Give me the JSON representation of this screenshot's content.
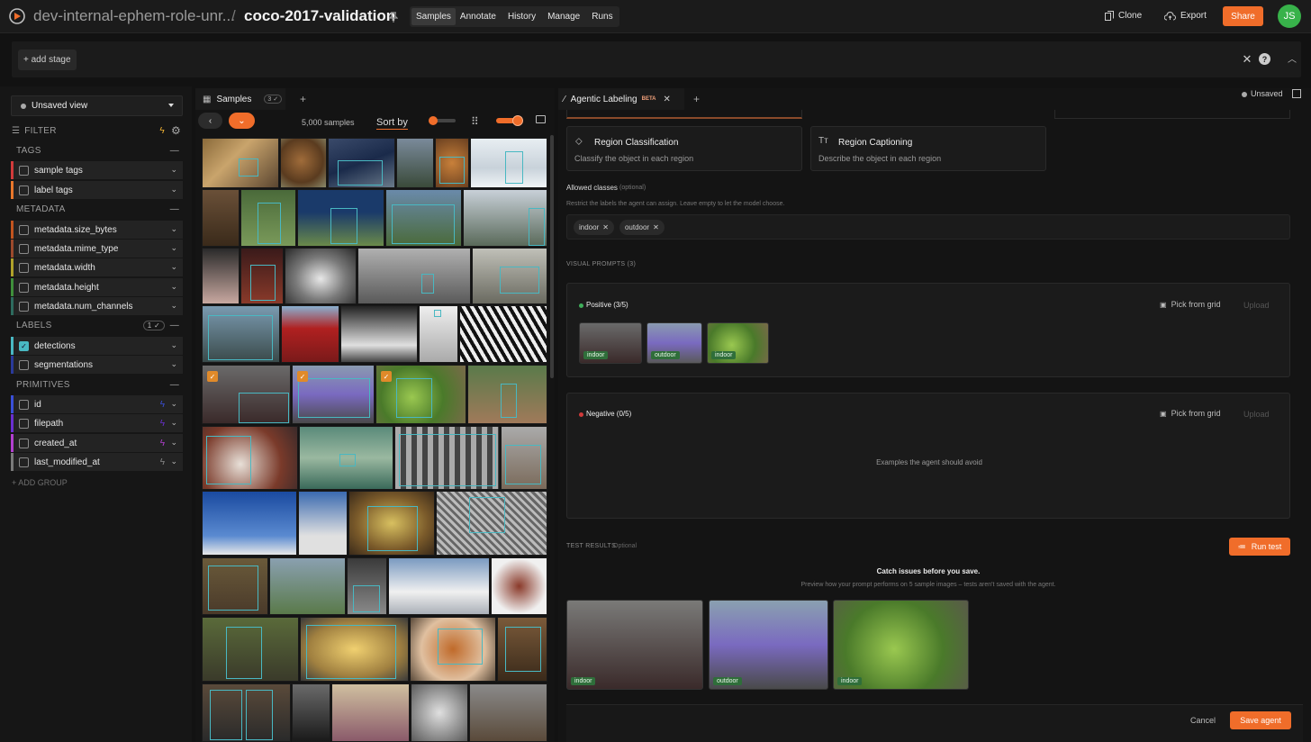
{
  "header": {
    "org": "dev-internal-ephem-role-unr...",
    "separator": "/",
    "dataset": "coco-2017-validation",
    "tabs": [
      {
        "label": "Samples",
        "active": true
      },
      {
        "label": "Annotate",
        "active": false
      },
      {
        "label": "History",
        "active": false
      },
      {
        "label": "Manage",
        "active": false
      },
      {
        "label": "Runs",
        "active": false
      }
    ],
    "clone_label": "Clone",
    "export_label": "Export",
    "share_label": "Share",
    "avatar_initials": "JS",
    "accent_color": "#f06d2a"
  },
  "stage_bar": {
    "add_stage_label": "+ add stage"
  },
  "sidebar": {
    "view_label": "Unsaved view",
    "filter_label": "FILTER",
    "groups": {
      "tags": "TAGS",
      "metadata": "METADATA",
      "labels": "LABELS",
      "labels_badge": "1 ✓",
      "primitives": "PRIMITIVES"
    },
    "tags": [
      {
        "label": "sample tags",
        "color": "#d13b3b"
      },
      {
        "label": "label tags",
        "color": "#e8762b"
      }
    ],
    "metadata": [
      {
        "label": "metadata.size_bytes",
        "color": "#c2541f"
      },
      {
        "label": "metadata.mime_type",
        "color": "#9c4a2c"
      },
      {
        "label": "metadata.width",
        "color": "#b0a12a"
      },
      {
        "label": "metadata.height",
        "color": "#3f8f3b"
      },
      {
        "label": "metadata.num_channels",
        "color": "#2d6b5e"
      }
    ],
    "labels": [
      {
        "label": "detections",
        "color": "#49b8c2",
        "checked": true
      },
      {
        "label": "segmentations",
        "color": "#2a3a9a",
        "checked": false
      }
    ],
    "primitives": [
      {
        "label": "id",
        "color": "#3a4fd8"
      },
      {
        "label": "filepath",
        "color": "#6a2fd0"
      },
      {
        "label": "created_at",
        "color": "#b23fd0"
      },
      {
        "label": "last_modified_at",
        "color": "#7a7a7a"
      }
    ],
    "add_group_label": "+ ADD GROUP"
  },
  "grid": {
    "tab_label": "Samples",
    "tab_badge": "3 ✓",
    "sample_count": "5,000 samples",
    "sort_label": "Sort by"
  },
  "labeling": {
    "tab_label": "Agentic Labeling",
    "beta": "BETA",
    "unsaved_label": "Unsaved",
    "region_classification": {
      "title": "Region Classification",
      "desc": "Classify the object in each region"
    },
    "region_captioning": {
      "title": "Region Captioning",
      "desc": "Describe the object in each region"
    },
    "allowed_classes_label": "Allowed classes",
    "allowed_optional": "(optional)",
    "allowed_help": "Restrict the labels the agent can assign. Leave empty to let the model choose.",
    "classes": [
      "indoor",
      "outdoor"
    ],
    "visual_prompts_label": "VISUAL PROMPTS (3)",
    "positive_label": "Positive (3/5)",
    "negative_label": "Negative (0/5)",
    "pick_from_grid": "Pick from grid",
    "upload": "Upload",
    "positive_thumbs": [
      "indoor",
      "outdoor",
      "indoor"
    ],
    "negative_empty": "Examples the agent should avoid",
    "test_results_label": "TEST RESULTS",
    "test_optional": "Optional",
    "run_test_label": "Run test",
    "catch_title": "Catch issues before you save.",
    "catch_desc": "Preview how your prompt performs on 5 sample images – tests aren't saved with the agent.",
    "result_thumbs": [
      "indoor",
      "outdoor",
      "indoor"
    ],
    "cancel_label": "Cancel",
    "save_label": "Save agent"
  }
}
